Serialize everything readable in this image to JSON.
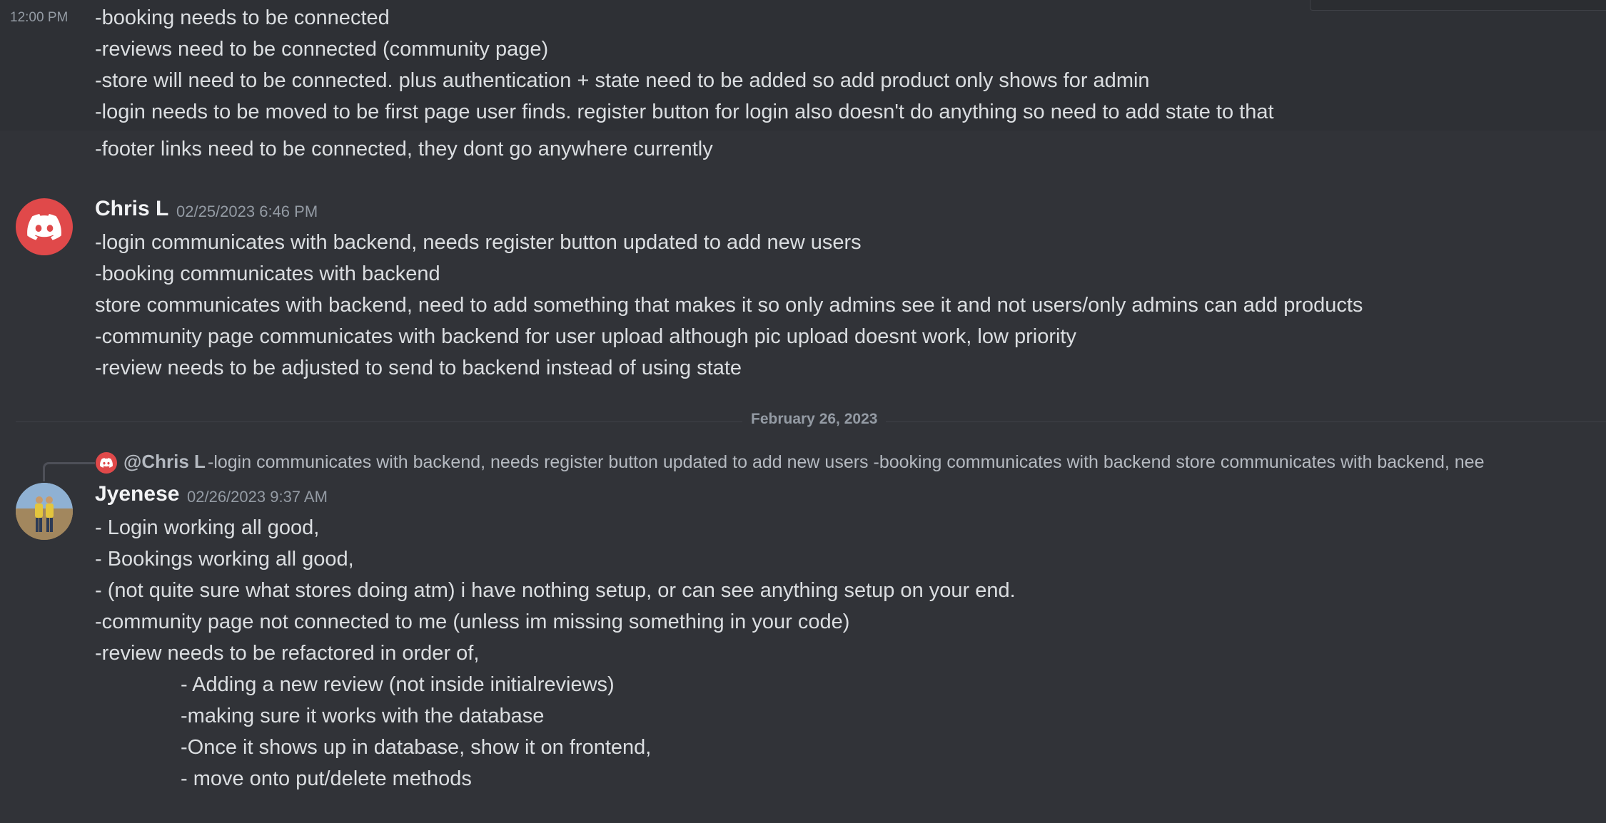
{
  "message_group_1": {
    "timestamp_short": "12:00 PM",
    "lines": [
      "-booking needs to be connected",
      "-reviews need to be connected (community page)",
      "-store will need to be connected. plus authentication + state need to be added so add product only shows for admin",
      "-login needs to be moved to be first page user finds. register button for login also doesn't do anything so need to  add state to that",
      "-footer links need to be connected, they dont go anywhere currently"
    ]
  },
  "message_2": {
    "author": "Chris L",
    "timestamp": "02/25/2023 6:46 PM",
    "lines": [
      "-login communicates with backend, needs register button updated to add new users",
      "-booking communicates with backend",
      "store communicates with backend, need to add something that makes it so only admins see it and not users/only admins can add products",
      "-community page communicates with backend for user upload although pic upload doesnt work, low priority",
      "-review needs to be adjusted to send to backend instead of using state"
    ]
  },
  "date_divider": "February 26, 2023",
  "message_3": {
    "reply": {
      "mention": "@Chris L",
      "preview": "-login communicates with backend, needs register button updated to add new users -booking communicates with backend store communicates with backend, nee"
    },
    "author": "Jyenese",
    "timestamp": "02/26/2023 9:37 AM",
    "lines": [
      "- Login working all good,",
      "- Bookings working all good,",
      "- (not quite sure what stores doing atm) i have nothing setup, or can see anything setup on your end.",
      "-community page not connected to me (unless im missing something in your code)",
      "-review needs to be refactored in order of,"
    ],
    "sub_lines": [
      "- Adding a new review (not inside initialreviews)",
      "-making sure it works with the database",
      "-Once it shows up in database, show it on frontend,",
      "- move onto put/delete methods"
    ]
  },
  "colors": {
    "background": "#313338",
    "text": "#dbdee1",
    "muted": "#949ba4",
    "discord_red": "#e0494a"
  }
}
